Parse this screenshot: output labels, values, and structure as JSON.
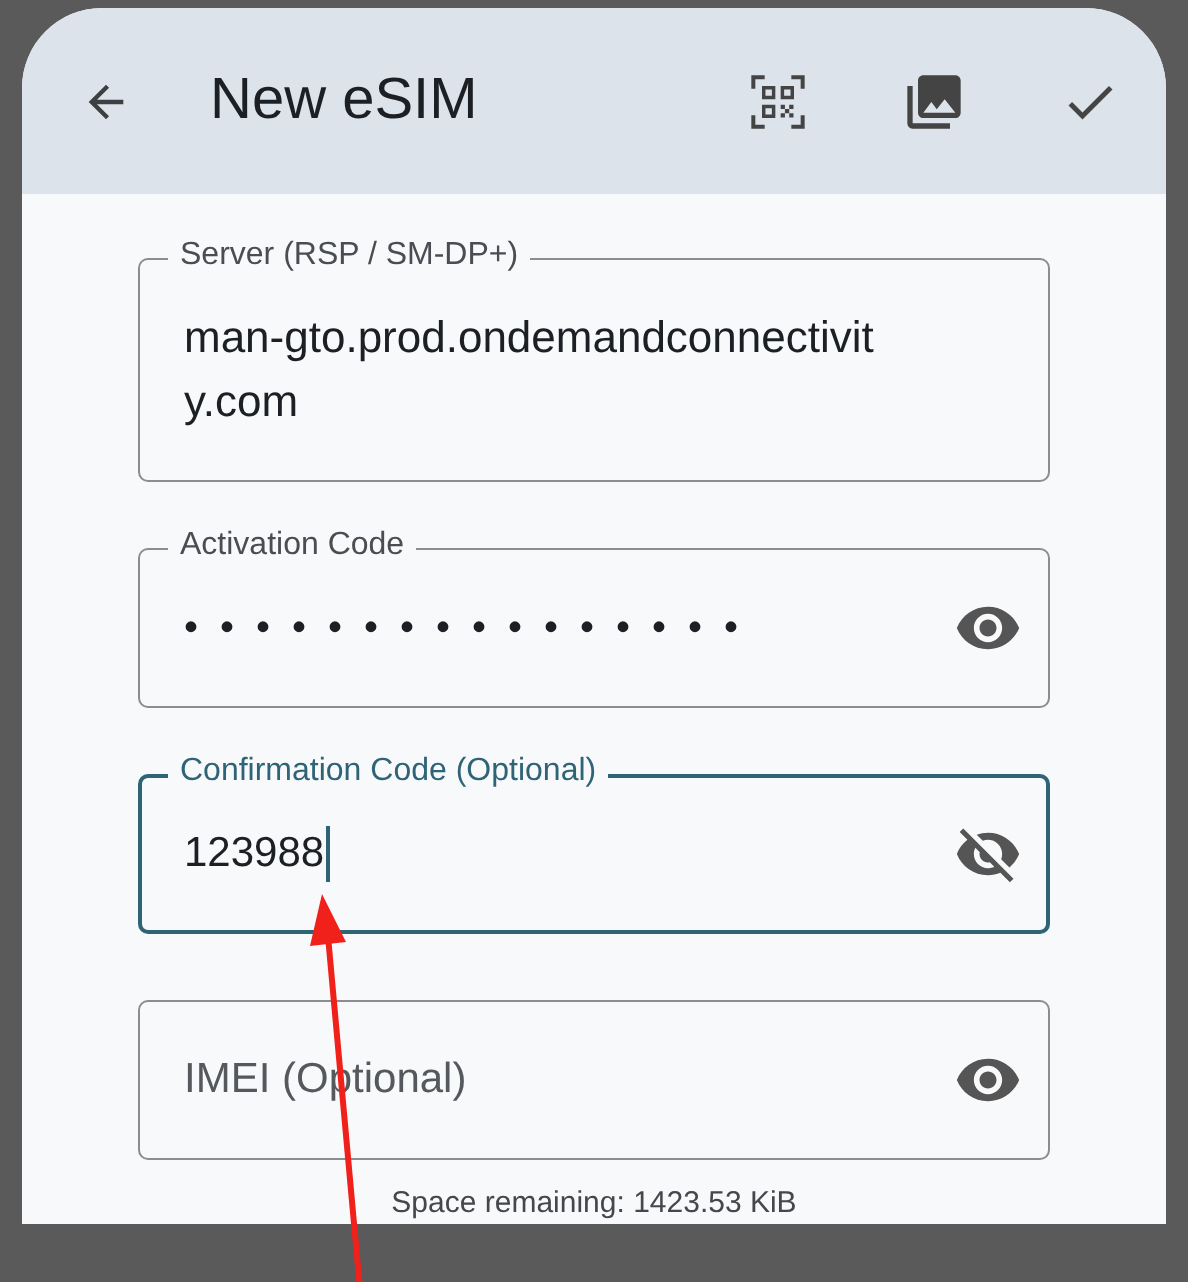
{
  "app_bar": {
    "title": "New eSIM"
  },
  "fields": [
    {
      "kind": "text",
      "label": "Server (RSP / SM-DP+)",
      "value": "man-gto.prod.ondemandconnectivity.com",
      "focused": false
    },
    {
      "kind": "secret",
      "label": "Activation Code",
      "value": "••••••••••••••••",
      "focused": false,
      "revealed": false
    },
    {
      "kind": "secret",
      "label": "Confirmation Code (Optional)",
      "value": "123988",
      "focused": true,
      "revealed": true
    },
    {
      "kind": "secret",
      "placeholder": "IMEI (Optional)",
      "focused": false,
      "revealed": false
    }
  ],
  "footer": "Space remaining: 1423.53 KiB"
}
